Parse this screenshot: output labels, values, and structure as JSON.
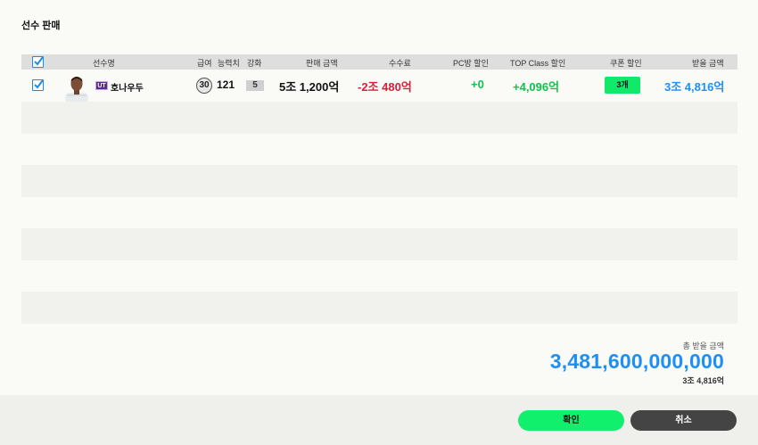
{
  "dialog": {
    "title": "선수 판매"
  },
  "table": {
    "headers": {
      "name": "선수명",
      "salary": "급여",
      "ovr": "능력치",
      "upgrade": "강화",
      "sale_price": "판매 금액",
      "fee": "수수료",
      "pc_discount": "PC방 할인",
      "top_class": "TOP Class 할인",
      "coupon": "쿠폰 할인",
      "receive": "받을 금액"
    },
    "rows": [
      {
        "checked": true,
        "position": "UT",
        "name": "호나우두",
        "salary": "30",
        "ovr": "121",
        "upgrade": "5",
        "sale_price": "5조 1,200억",
        "fee": "-2조 480억",
        "pc_discount": "+0",
        "top_class": "+4,096억",
        "coupon": "3개",
        "receive": "3조 4,816억"
      }
    ]
  },
  "summary": {
    "label": "총 받을 금액",
    "value": "3,481,600,000,000",
    "value_short": "3조 4,816억"
  },
  "buttons": {
    "confirm": "확인",
    "cancel": "취소"
  },
  "colors": {
    "accent_blue": "#1e90f5",
    "fee_red": "#d3213a",
    "gain_green": "#12c24d",
    "coupon_green": "#12e86a",
    "confirm_green": "#11f06c",
    "cancel_dark": "#444444"
  }
}
